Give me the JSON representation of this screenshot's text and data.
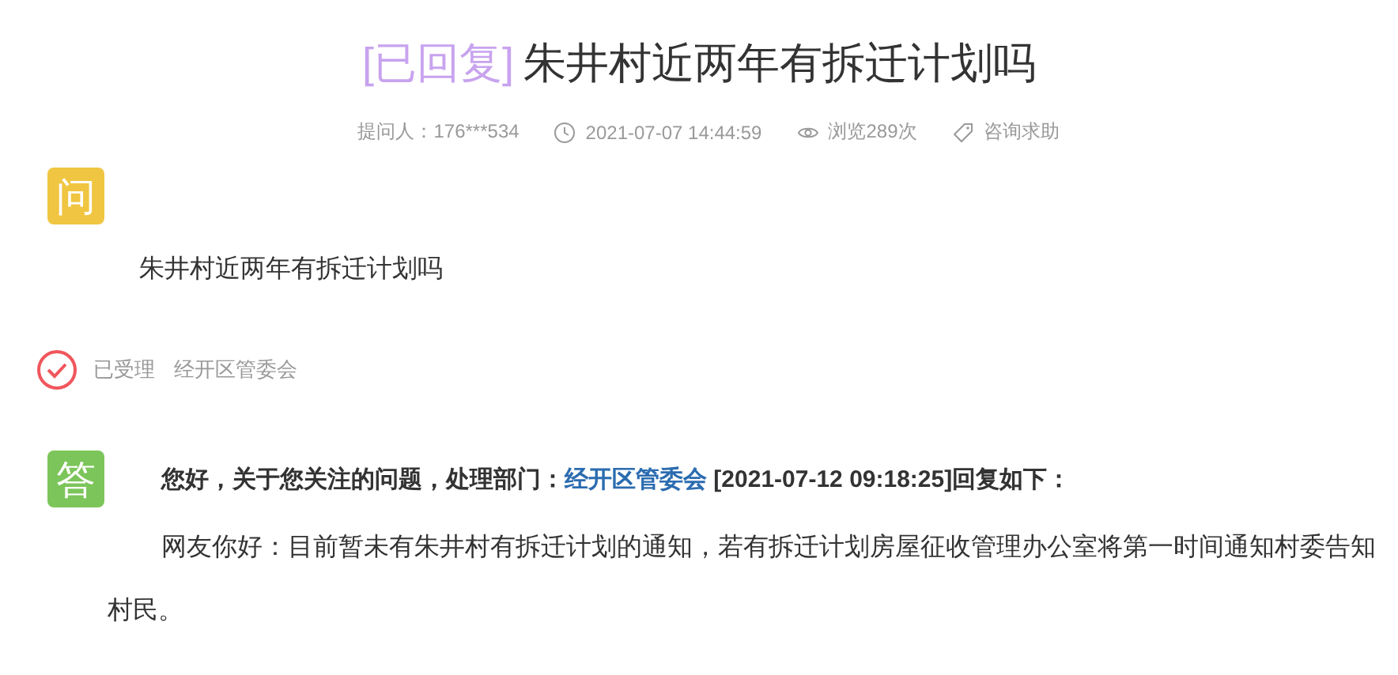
{
  "title": {
    "status": "[已回复]",
    "text": "朱井村近两年有拆迁计划吗"
  },
  "meta": [
    {
      "kind": "text",
      "text": "提问人：176***534"
    },
    {
      "kind": "clock",
      "text": "2021-07-07 14:44:59"
    },
    {
      "kind": "eye",
      "text": "浏览289次"
    },
    {
      "kind": "tag",
      "text": "咨询求助"
    }
  ],
  "question": {
    "badge": "问",
    "text": "朱井村近两年有拆迁计划吗"
  },
  "status": {
    "label": "已受理",
    "department": "经开区管委会"
  },
  "answer": {
    "badge": "答",
    "intro": "您好，关于您关注的问题，处理部门：",
    "department": "经开区管委会",
    "suffix": "[2021-07-12 09:18:25]回复如下：",
    "body": "网友你好：目前暂未有朱井村有拆迁计划的通知，若有拆迁计划房屋征收管理办公室将第一时间通知村委告知村民。"
  }
}
